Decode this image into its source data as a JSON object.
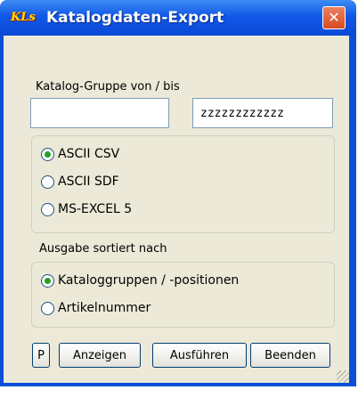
{
  "window": {
    "icon_text": "KLs",
    "title": "Katalogdaten-Export",
    "close_glyph": "✕"
  },
  "group_range": {
    "label": "Katalog-Gruppe  von / bis",
    "from_value": "",
    "to_value": "zzzzzzzzzzzz"
  },
  "format_options": [
    {
      "label": "ASCII CSV",
      "selected": true
    },
    {
      "label": "ASCII SDF",
      "selected": false
    },
    {
      "label": "MS-EXCEL 5",
      "selected": false
    }
  ],
  "sort": {
    "label": "Ausgabe sortiert nach",
    "options": [
      {
        "label": "Kataloggruppen / -positionen",
        "selected": true
      },
      {
        "label": "Artikelnummer",
        "selected": false
      }
    ]
  },
  "buttons": {
    "p": "P",
    "show": "Anzeigen",
    "run": "Ausführen",
    "exit": "Beenden"
  }
}
